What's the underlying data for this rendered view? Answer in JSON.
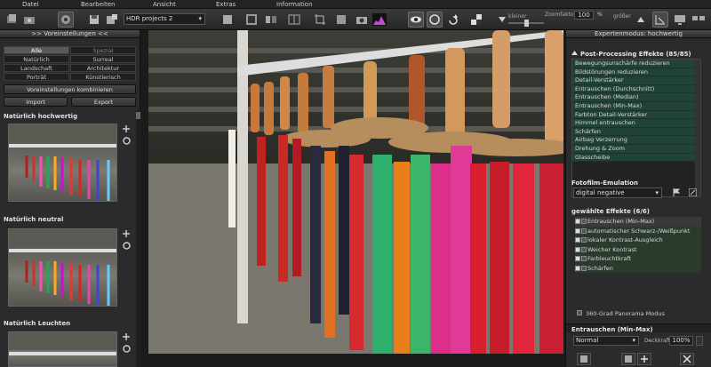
{
  "menu": {
    "file": "Datei",
    "edit": "Bearbeiten",
    "view": "Ansicht",
    "extras": "Extras",
    "info": "Information"
  },
  "toolbar": {
    "project_select": "HDR projects 2",
    "zoom_label": "Zoomfaktor",
    "zoom_value": "100",
    "zoom_unit": "%",
    "smaller_label": "kleiner",
    "bigger_label": "größer"
  },
  "left_panel": {
    "header": ">> Voreinstellungen <<",
    "categories": [
      "Alle",
      "Spezial",
      "Natürlich",
      "Surreal",
      "Landschaft",
      "Architektur",
      "Porträt",
      "Künstlerisch"
    ],
    "combine_button": "Voreinstellungen kombinieren",
    "import_button": "Import",
    "export_button": "Export",
    "presets": [
      {
        "title": "Natürlich hochwertig"
      },
      {
        "title": "Natürlich neutral"
      },
      {
        "title": "Natürlich Leuchten"
      }
    ]
  },
  "right_panel": {
    "header": "Expertenmodus: hochwertig",
    "post_title": "Post-Processing Effekte (85/85)",
    "effects": [
      "Bewegungsunschärfe reduzieren",
      "Bildstörungen reduzieren",
      "Detail-Verstärker",
      "Entrauschen (Durchschnitt)",
      "Entrauschen (Median)",
      "Entrauschen (Min-Max)",
      "Farbton Detail-Verstärker",
      "Himmel entrauschen",
      "Schärfen",
      "Airbag Verzerrung",
      "Drehung & Zoom",
      "Glasscheibe"
    ],
    "film_title": "Fotofilm-Emulation",
    "film_value": "digital negative",
    "selected_title": "gewählte Effekte (6/6)",
    "selected_effects": [
      "Entrauschen (Min-Max)",
      "automatischer Schwarz-/Weißpunkt",
      "lokaler Kontrast-Ausgleich",
      "Weicher Kontrast",
      "Farbleuchtkraft",
      "Schärfen"
    ],
    "panorama_label": "360-Grad Panorama Modus",
    "detail_title": "Entrauschen (Min-Max)",
    "blend_mode": "Normal",
    "opacity_label": "Deckkraft",
    "opacity_value": "100%"
  },
  "colors": {
    "accent_green": "#214335",
    "panel": "#2b2b2b",
    "toolbar": "#2e2e2e"
  }
}
